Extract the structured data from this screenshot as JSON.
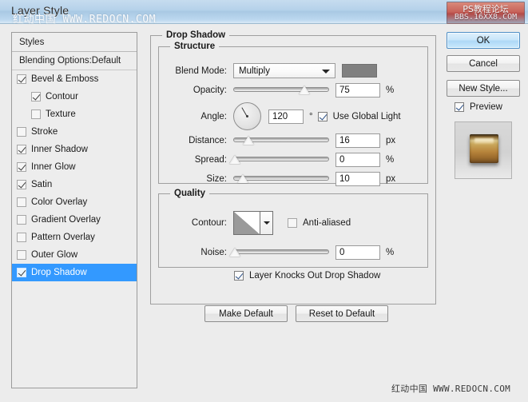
{
  "window": {
    "title": "Layer Style"
  },
  "watermarks": {
    "title_overlay": "红动中国 WWW.REDOCN.COM",
    "badge_line1": "PS教程论坛",
    "badge_line2": "BBS.16XX8.COM",
    "bottom": "红动中国 WWW.REDOCN.COM"
  },
  "styles_panel": {
    "header": "Styles",
    "blending_options": "Blending Options:Default",
    "items": [
      {
        "label": "Bevel & Emboss",
        "checked": true,
        "indent": false,
        "selected": false
      },
      {
        "label": "Contour",
        "checked": true,
        "indent": true,
        "selected": false
      },
      {
        "label": "Texture",
        "checked": false,
        "indent": true,
        "selected": false
      },
      {
        "label": "Stroke",
        "checked": false,
        "indent": false,
        "selected": false
      },
      {
        "label": "Inner Shadow",
        "checked": true,
        "indent": false,
        "selected": false
      },
      {
        "label": "Inner Glow",
        "checked": true,
        "indent": false,
        "selected": false
      },
      {
        "label": "Satin",
        "checked": true,
        "indent": false,
        "selected": false
      },
      {
        "label": "Color Overlay",
        "checked": false,
        "indent": false,
        "selected": false
      },
      {
        "label": "Gradient Overlay",
        "checked": false,
        "indent": false,
        "selected": false
      },
      {
        "label": "Pattern Overlay",
        "checked": false,
        "indent": false,
        "selected": false
      },
      {
        "label": "Outer Glow",
        "checked": false,
        "indent": false,
        "selected": false
      },
      {
        "label": "Drop Shadow",
        "checked": true,
        "indent": false,
        "selected": true
      }
    ]
  },
  "main": {
    "section_title": "Drop Shadow",
    "structure": {
      "title": "Structure",
      "blend_mode_label": "Blend Mode:",
      "blend_mode_value": "Multiply",
      "shadow_color": "#808080",
      "opacity_label": "Opacity:",
      "opacity_value": "75",
      "opacity_unit": "%",
      "angle_label": "Angle:",
      "angle_value": "120",
      "angle_unit": "°",
      "use_global_light_label": "Use Global Light",
      "use_global_light_checked": true,
      "distance_label": "Distance:",
      "distance_value": "16",
      "distance_unit": "px",
      "spread_label": "Spread:",
      "spread_value": "0",
      "spread_unit": "%",
      "size_label": "Size:",
      "size_value": "10",
      "size_unit": "px"
    },
    "quality": {
      "title": "Quality",
      "contour_label": "Contour:",
      "anti_aliased_label": "Anti-aliased",
      "anti_aliased_checked": false,
      "noise_label": "Noise:",
      "noise_value": "0",
      "noise_unit": "%"
    },
    "layer_knocks_out_label": "Layer Knocks Out Drop Shadow",
    "layer_knocks_out_checked": true,
    "make_default_label": "Make Default",
    "reset_default_label": "Reset to Default"
  },
  "right_panel": {
    "ok_label": "OK",
    "cancel_label": "Cancel",
    "new_style_label": "New Style...",
    "preview_label": "Preview",
    "preview_checked": true
  },
  "colors": {
    "selection_blue": "#3399ff",
    "dialog_bg": "#ececec",
    "titlebar_blue": "#b6d2ea"
  }
}
